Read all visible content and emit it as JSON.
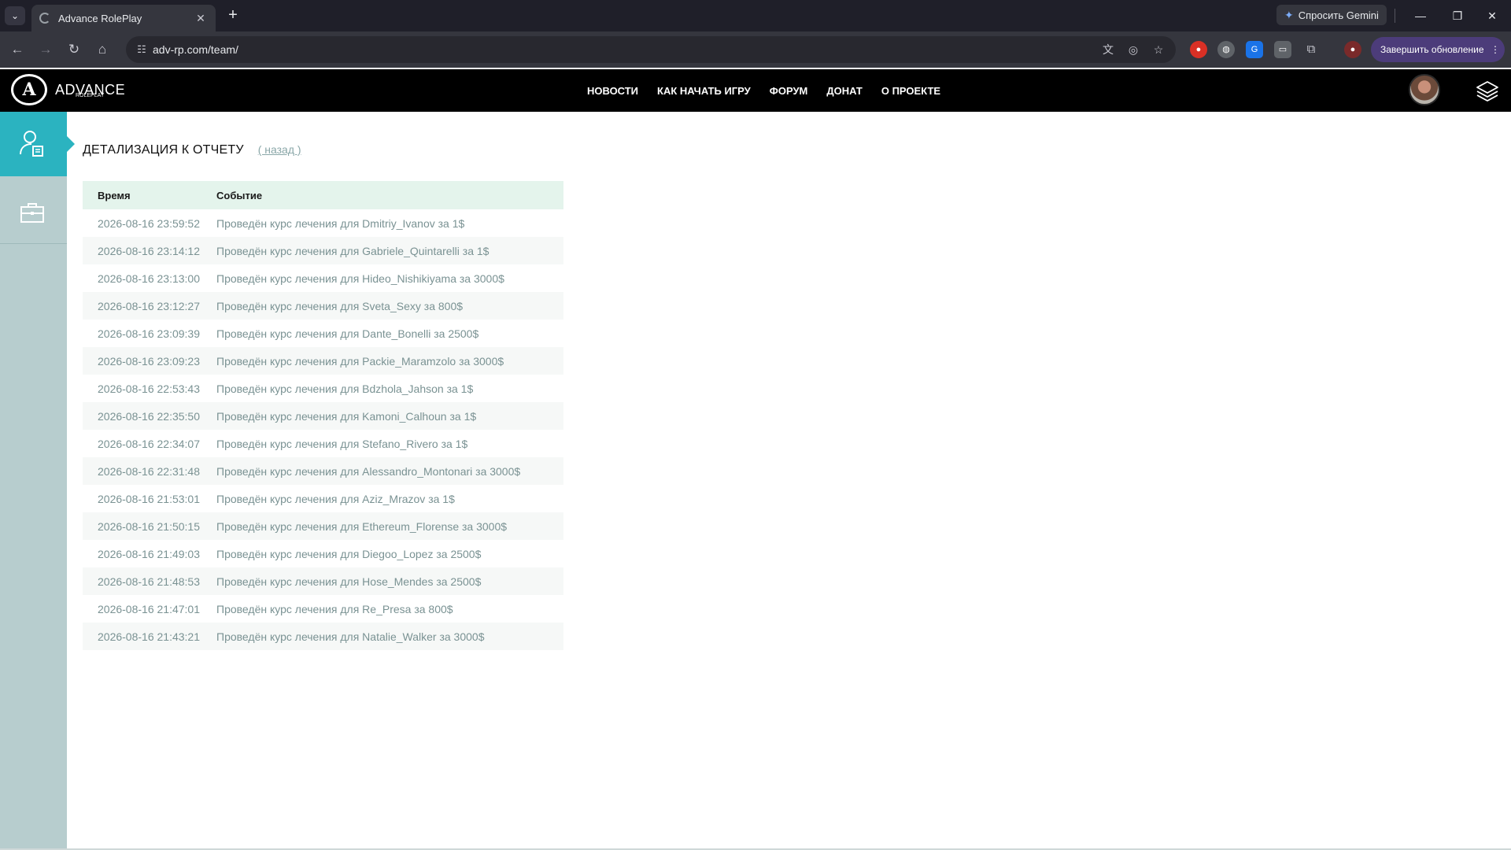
{
  "browser": {
    "tab_title": "Advance RolePlay",
    "gemini_label": "Спросить Gemini",
    "url": "adv-rp.com/team/",
    "update_label": "Завершить обновление"
  },
  "site": {
    "logo_text": "ADVANCE",
    "logo_subtext": "ROLEPLAY",
    "logo_letter": "A",
    "nav": [
      "НОВОСТИ",
      "КАК НАЧАТЬ ИГРУ",
      "ФОРУМ",
      "ДОНАТ",
      "О ПРОЕКТЕ"
    ]
  },
  "page": {
    "title": "ДЕТАЛИЗАЦИЯ К ОТЧЕТУ",
    "back_link": "( назад )"
  },
  "table": {
    "headers": [
      "Время",
      "Событие"
    ],
    "rows": [
      [
        "2026-08-16 23:59:52",
        "Проведён курс лечения для Dmitriy_Ivanov за 1$"
      ],
      [
        "2026-08-16 23:14:12",
        "Проведён курс лечения для Gabriele_Quintarelli за 1$"
      ],
      [
        "2026-08-16 23:13:00",
        "Проведён курс лечения для Hideo_Nishikiyama за 3000$"
      ],
      [
        "2026-08-16 23:12:27",
        "Проведён курс лечения для Sveta_Sexy за 800$"
      ],
      [
        "2026-08-16 23:09:39",
        "Проведён курс лечения для Dante_Bonelli за 2500$"
      ],
      [
        "2026-08-16 23:09:23",
        "Проведён курс лечения для Packie_Maramzolo за 3000$"
      ],
      [
        "2026-08-16 22:53:43",
        "Проведён курс лечения для Bdzhola_Jahson за 1$"
      ],
      [
        "2026-08-16 22:35:50",
        "Проведён курс лечения для Kamoni_Calhoun за 1$"
      ],
      [
        "2026-08-16 22:34:07",
        "Проведён курс лечения для Stefano_Rivero за 1$"
      ],
      [
        "2026-08-16 22:31:48",
        "Проведён курс лечения для Alessandro_Montonari за 3000$"
      ],
      [
        "2026-08-16 21:53:01",
        "Проведён курс лечения для Aziz_Mrazov за 1$"
      ],
      [
        "2026-08-16 21:50:15",
        "Проведён курс лечения для Ethereum_Florense за 3000$"
      ],
      [
        "2026-08-16 21:49:03",
        "Проведён курс лечения для Diegoo_Lopez за 2500$"
      ],
      [
        "2026-08-16 21:48:53",
        "Проведён курс лечения для Hose_Mendes за 2500$"
      ],
      [
        "2026-08-16 21:47:01",
        "Проведён курс лечения для Re_Presa за 800$"
      ],
      [
        "2026-08-16 21:43:21",
        "Проведён курс лечения для Natalie_Walker за 3000$"
      ]
    ]
  },
  "colors": {
    "header_bg": "#000000",
    "sidebar_bg": "#b7cdce",
    "sidebar_active": "#2bb3c0",
    "table_header_bg": "#e4f4ec",
    "cell_text": "#7a9293"
  }
}
